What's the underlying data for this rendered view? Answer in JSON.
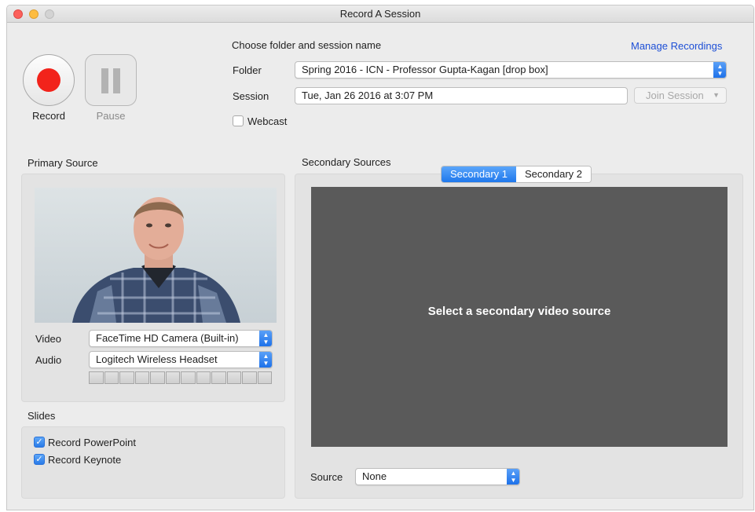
{
  "window": {
    "title": "Record A Session"
  },
  "controls": {
    "record_label": "Record",
    "pause_label": "Pause"
  },
  "session": {
    "heading": "Choose folder and session name",
    "manage_link": "Manage Recordings",
    "folder_label": "Folder",
    "folder_value": "Spring 2016 - ICN - Professor Gupta-Kagan [drop box]",
    "session_label": "Session",
    "session_value": "Tue, Jan 26 2016 at 3:07 PM",
    "join_label": "Join Session",
    "webcast_label": "Webcast",
    "webcast_checked": false
  },
  "primary": {
    "title": "Primary Source",
    "video_label": "Video",
    "video_value": "FaceTime HD Camera (Built-in)",
    "audio_label": "Audio",
    "audio_value": "Logitech Wireless Headset",
    "meter_level": 0
  },
  "slides": {
    "title": "Slides",
    "items": [
      {
        "label": "Record PowerPoint",
        "checked": true
      },
      {
        "label": "Record Keynote",
        "checked": true
      }
    ]
  },
  "secondary": {
    "title": "Secondary Sources",
    "tabs": [
      {
        "label": "Secondary 1",
        "active": true
      },
      {
        "label": "Secondary 2",
        "active": false
      }
    ],
    "placeholder": "Select a secondary video source",
    "source_label": "Source",
    "source_value": "None"
  },
  "colors": {
    "record": "#f2231b",
    "accent": "#1f78ec",
    "link": "#1d4fd6",
    "video_bg": "#5a5a5a"
  }
}
